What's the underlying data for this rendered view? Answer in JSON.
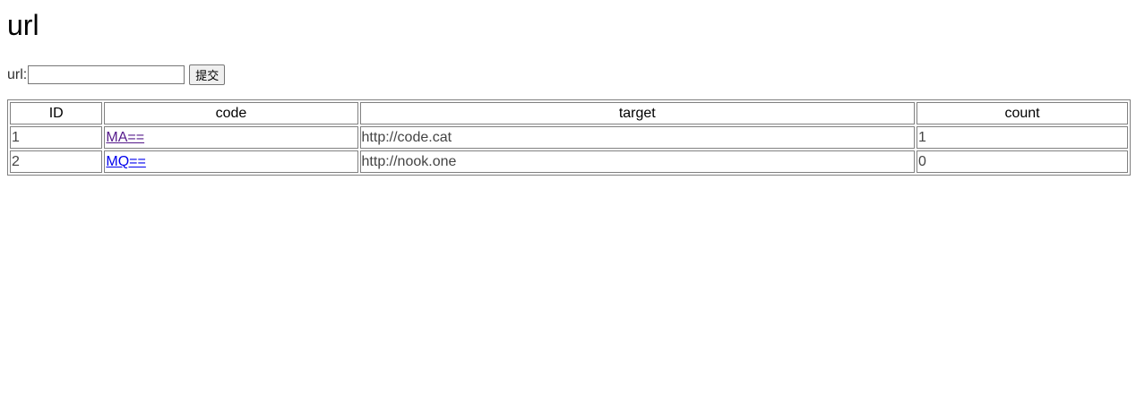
{
  "page": {
    "title": "url"
  },
  "form": {
    "label": "url:",
    "input_value": "",
    "submit_label": "提交"
  },
  "table": {
    "headers": {
      "id": "ID",
      "code": "code",
      "target": "target",
      "count": "count"
    },
    "rows": [
      {
        "id": "1",
        "code": "MA==",
        "target": "http://code.cat",
        "count": "1"
      },
      {
        "id": "2",
        "code": "MQ==",
        "target": "http://nook.one",
        "count": "0"
      }
    ]
  },
  "colors": {
    "visited_link": "#551a8b",
    "unvisited_link": "#0000ee",
    "border": "#808080"
  }
}
